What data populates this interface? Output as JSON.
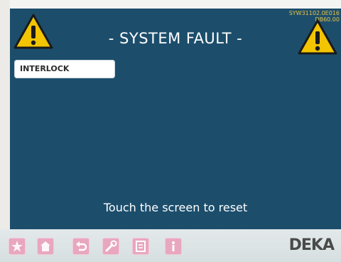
{
  "screen": {
    "title": "- SYSTEM FAULT -",
    "version_line1": "SYW31102.0E016",
    "version_line2": "DB60.00",
    "fault": {
      "label": "INTERLOCK"
    },
    "reset_prompt": "Touch the screen to reset"
  },
  "toolbar": {
    "buttons": [
      {
        "icon": "star-icon"
      },
      {
        "icon": "home-icon"
      },
      {
        "icon": "undo-icon"
      },
      {
        "icon": "tools-icon"
      },
      {
        "icon": "document-icon"
      },
      {
        "icon": "info-icon"
      }
    ],
    "brand": "DEKA"
  },
  "colors": {
    "screen_bg": "#1c4e6c",
    "warning_yellow": "#f2c500",
    "version_text": "#e9c447",
    "toolbar_button": "#e8a7bf"
  }
}
